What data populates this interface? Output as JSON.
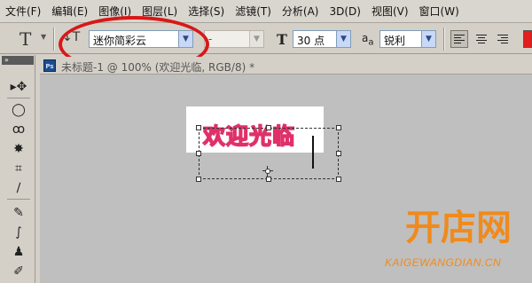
{
  "menubar": {
    "items": [
      "文件(F)",
      "编辑(E)",
      "图像(I)",
      "图层(L)",
      "选择(S)",
      "滤镜(T)",
      "分析(A)",
      "3D(D)",
      "视图(V)",
      "窗口(W)"
    ]
  },
  "options": {
    "tool_icon": "T",
    "font_family": "迷你简彩云",
    "font_style": "-",
    "font_size": "30 点",
    "anti_alias": "锐利",
    "text_color": "#e41e1e"
  },
  "document": {
    "title": "未标题-1 @ 100% (欢迎光临, RGB/8) *",
    "canvas_text": "欢迎光临"
  },
  "watermark": {
    "logo_text": "开店网",
    "url": "KAIGEWANGDIAN.CN"
  },
  "colors": {
    "annotation": "#d81818",
    "text_stroke": "#e0306a",
    "watermark": "#f08a1c"
  }
}
